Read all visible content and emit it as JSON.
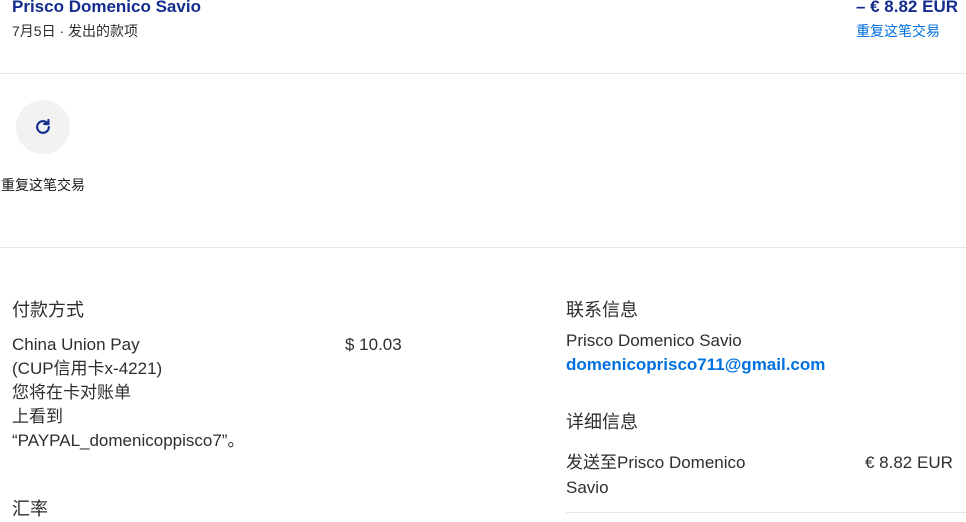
{
  "header": {
    "merchant": "Prisco Domenico Savio",
    "subline": "7月5日 · 发出的款项",
    "amount": "– € 8.82 EUR",
    "repeat_link": "重复这笔交易"
  },
  "action": {
    "icon": "refresh-icon",
    "label": "重复这笔交易"
  },
  "payment": {
    "title": "付款方式",
    "method_lines": [
      "China Union Pay",
      "(CUP信用卡x-4221)",
      "您将在卡对账单",
      "上看到",
      "“PAYPAL_domenicopрisco7”。"
    ],
    "amount": "$ 10.03",
    "exchange_title": "汇率"
  },
  "contact": {
    "title": "联系信息",
    "name": "Prisco Domenico Savio",
    "email": "domenicoprisco711@gmail.com"
  },
  "details": {
    "title": "详细信息",
    "sent_to_lines": [
      "发送至Prisco Domenico",
      "Savio"
    ],
    "amount": "€ 8.82 EUR"
  },
  "colors": {
    "brand_dark": "#142c8e",
    "link": "#0070e0"
  }
}
